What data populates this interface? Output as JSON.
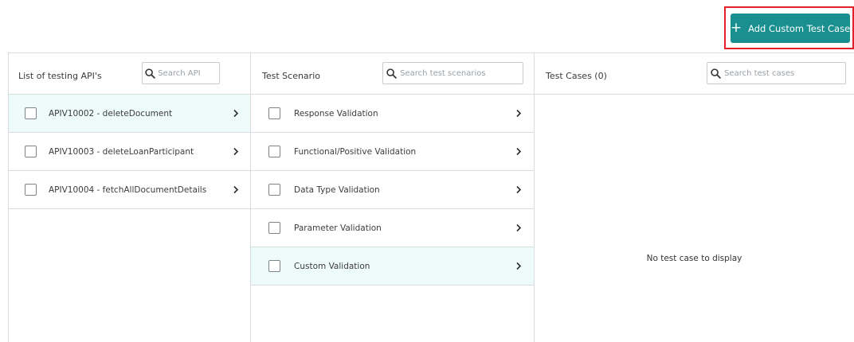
{
  "toolbar": {
    "add_button_label": "Add Custom Test Case",
    "add_button_icon": "plus-icon",
    "accent_color": "#1a8f8f",
    "highlight_border_color": "#e3202a"
  },
  "apis": {
    "title": "List of testing API's",
    "search_placeholder": "Search API",
    "items": [
      {
        "label": "APIV10002 - deleteDocument",
        "selected": true
      },
      {
        "label": "APIV10003 - deleteLoanParticipant",
        "selected": false
      },
      {
        "label": "APIV10004 - fetchAllDocumentDetails",
        "selected": false
      }
    ]
  },
  "scenarios": {
    "title": "Test Scenario",
    "search_placeholder": "Search test scenarios",
    "items": [
      {
        "label": "Response Validation",
        "selected": false
      },
      {
        "label": "Functional/Positive Validation",
        "selected": false
      },
      {
        "label": "Data Type Validation",
        "selected": false
      },
      {
        "label": "Parameter Validation",
        "selected": false
      },
      {
        "label": "Custom Validation",
        "selected": true
      }
    ]
  },
  "test_cases": {
    "title": "Test Cases (0)",
    "search_placeholder": "Search test cases",
    "empty_message": "No test case to display"
  },
  "colors": {
    "selected_row_bg": "#eefbfb",
    "border": "#dadde0"
  }
}
